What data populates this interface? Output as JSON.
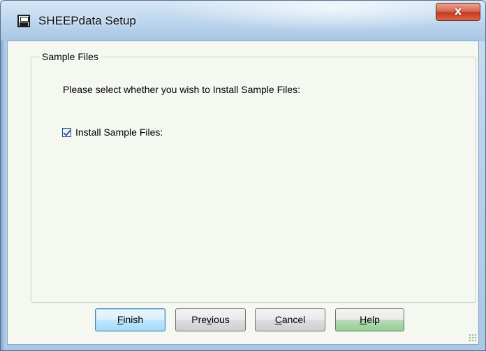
{
  "window": {
    "title": "SHEEPdata Setup",
    "close_glyph": "x"
  },
  "group": {
    "legend": "Sample Files",
    "prompt": "Please select whether you wish to Install Sample Files:",
    "checkbox": {
      "label": "Install Sample Files:",
      "checked": true
    }
  },
  "buttons": {
    "finish": "Finish",
    "previous": "Previous",
    "cancel": "Cancel",
    "help": "Help"
  }
}
